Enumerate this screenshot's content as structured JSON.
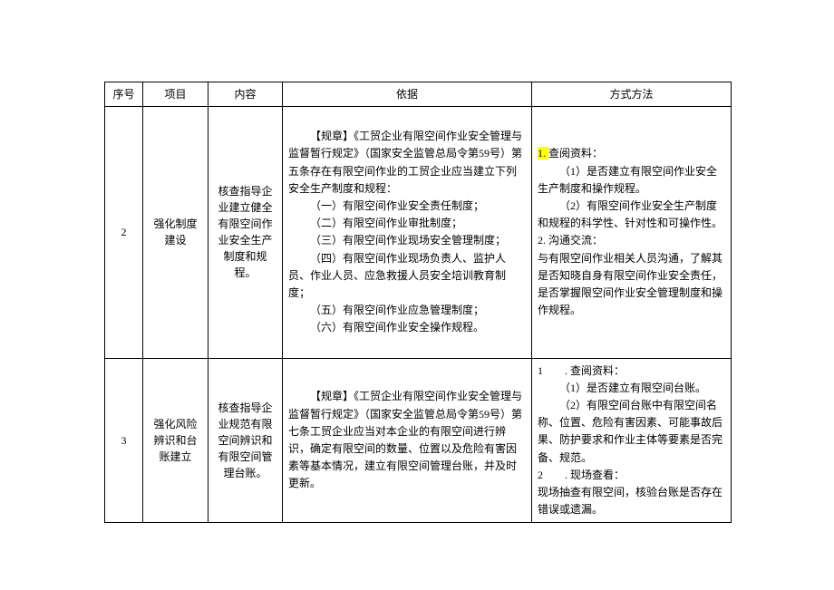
{
  "table": {
    "headers": {
      "seq": "序号",
      "item": "项目",
      "content": "内容",
      "basis": "依据",
      "method": "方式方法"
    },
    "rows": [
      {
        "seq": "2",
        "item": "强化制度建设",
        "content": "核查指导企业建立健全有限空间作业安全生产制度和规程。",
        "basis": {
          "intro": "【规章】《工贸企业有限空间作业安全管理与监督暂行规定》（国家安全监管总局令第59号）第五条存在有限空间作业的工贸企业应当建立下列安全生产制度和规程：",
          "items": [
            "（一）有限空间作业安全责任制度；",
            "（二）有限空间作业审批制度；",
            "（三）有限空间作业现场安全管理制度；",
            "（四）有限空间作业现场负责人、监护人员、作业人员、应急救援人员安全培训教育制度；",
            "（五）有限空间作业应急管理制度；",
            "（六）有限空间作业安全操作规程。"
          ]
        },
        "method": {
          "h1_hl": "1. ",
          "h1": "查阅资料：",
          "m1a": "（1）是否建立有限空间作业安全生产制度和操作规程。",
          "m1b": "（2）有限空间作业安全生产制度和规程的科学性、针对性和可操作性。",
          "h2": "2. 沟通交流：",
          "m2": "与有限空间作业相关人员沟通，了解其是否知晓自身有限空间作业安全责任，是否掌握限空间作业安全管理制度和操作规程。"
        }
      },
      {
        "seq": "3",
        "item": "强化风险辨识和台账建立",
        "content": "核查指导企业规范有限空间辨识和有限空间管理台账。",
        "basis": {
          "intro": "【规章】《工贸企业有限空间作业安全管理与监督暂行规定》（国家安全监管总局令第59号）第七条工贸企业应当对本企业的有限空间进行辨识，确定有限空间的数量、位置以及危险有害因素等基本情况，建立有限空间管理台账，并及时更新。"
        },
        "method": {
          "h1": "1　　. 查阅资料：",
          "m1a": "（1）是否建立有限空间台账。",
          "m1b": "（2）有限空间台账中有限空间名称、位置、危险有害因素、可能事故后果、防护要求和作业主体等要素是否完备、规范。",
          "h2": "2　　. 现场查看：",
          "m2": "现场抽查有限空间，核验台账是否存在错误或遗漏。"
        }
      }
    ]
  }
}
